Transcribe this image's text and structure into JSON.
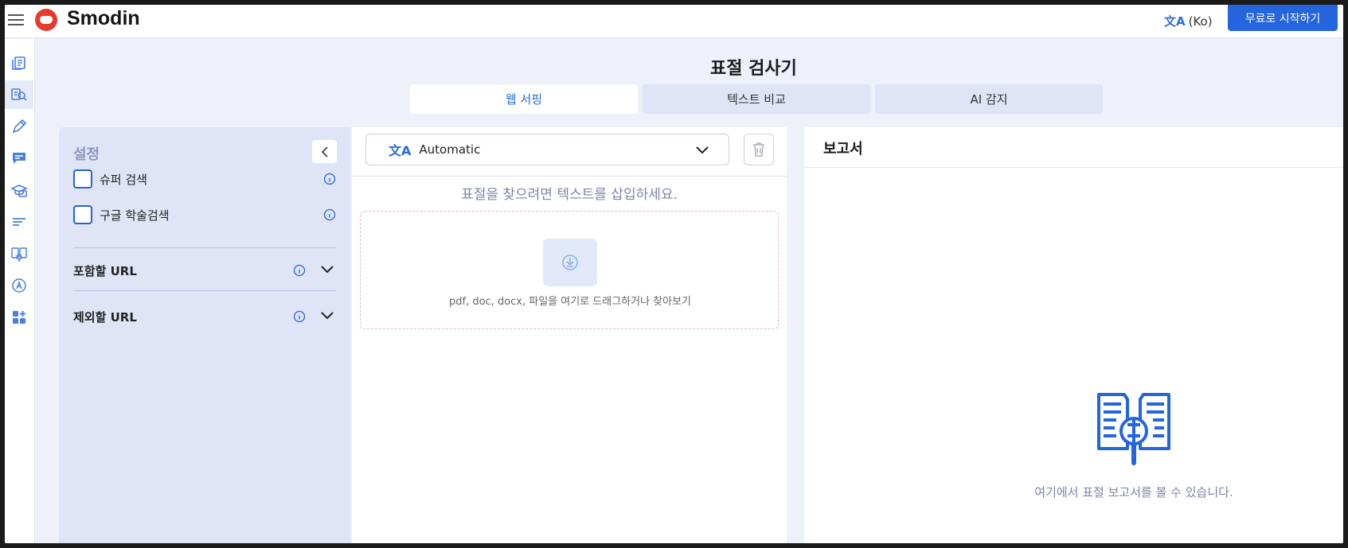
{
  "header": {
    "logo_text": "Smodin",
    "language_label": "(Ko)",
    "start_button": "무료로 시작하기"
  },
  "rail": {
    "items": [
      "documents-icon",
      "plagiarism-icon",
      "pen-icon",
      "chat-icon",
      "graduation-icon",
      "text-lines-icon",
      "compare-icon",
      "ai-letter-icon",
      "apps-add-icon"
    ]
  },
  "page": {
    "title": "표절 검사기",
    "tabs": [
      {
        "label": "웹 서핑",
        "active": true
      },
      {
        "label": "텍스트 비교",
        "active": false
      },
      {
        "label": "AI 감지",
        "active": false
      }
    ]
  },
  "settings": {
    "title": "설정",
    "options": [
      {
        "label": "슈퍼 검색",
        "checked": false
      },
      {
        "label": "구글 학술검색",
        "checked": false
      }
    ],
    "include_url_label": "포함할 URL",
    "exclude_url_label": "제외할 URL"
  },
  "input": {
    "language_value": "Automatic",
    "placeholder": "표절을 찾으려면 텍스트를 삽입하세요.",
    "drop_text": "pdf, doc, docx, 파일을 여기로 드래그하거나 찾아보기"
  },
  "report": {
    "title": "보고서",
    "empty_text": "여기에서 표절 보고서를 볼 수 있습니다."
  },
  "colors": {
    "accent": "#2464dc",
    "panel_bg": "#dfe5f6",
    "page_bg": "#eef0fa"
  }
}
